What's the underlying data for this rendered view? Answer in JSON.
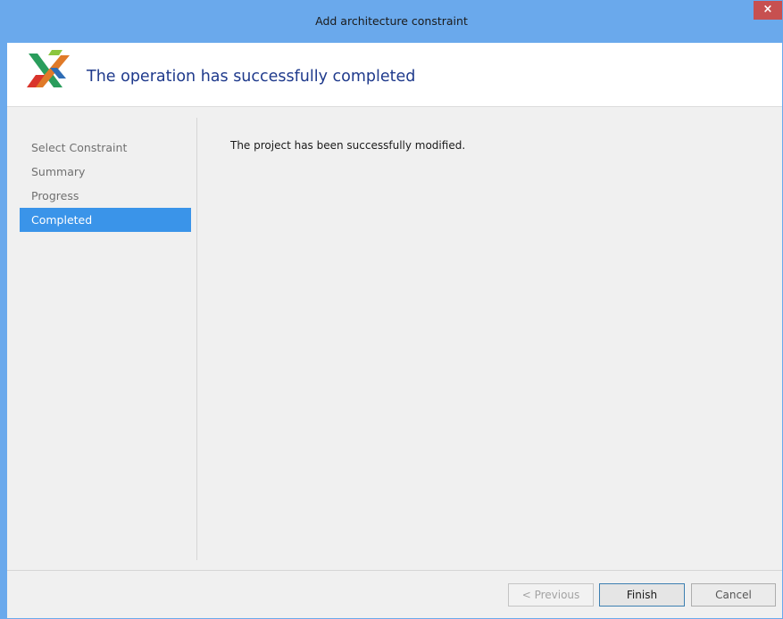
{
  "window": {
    "title": "Add architecture constraint",
    "close_symbol": "×"
  },
  "header": {
    "title": "The operation has successfully completed",
    "logo_icon": "x-cross-logo-icon"
  },
  "sidebar": {
    "items": [
      {
        "label": "Select Constraint",
        "active": false
      },
      {
        "label": "Summary",
        "active": false
      },
      {
        "label": "Progress",
        "active": false
      },
      {
        "label": "Completed",
        "active": true
      }
    ]
  },
  "main": {
    "message": "The project has been successfully modified."
  },
  "footer": {
    "previous_label": "< Previous",
    "finish_label": "Finish",
    "cancel_label": "Cancel"
  },
  "colors": {
    "titlebar": "#6aa9ec",
    "accent": "#3a94e9",
    "header_title": "#1f3a8c",
    "close_button": "#c75050"
  }
}
